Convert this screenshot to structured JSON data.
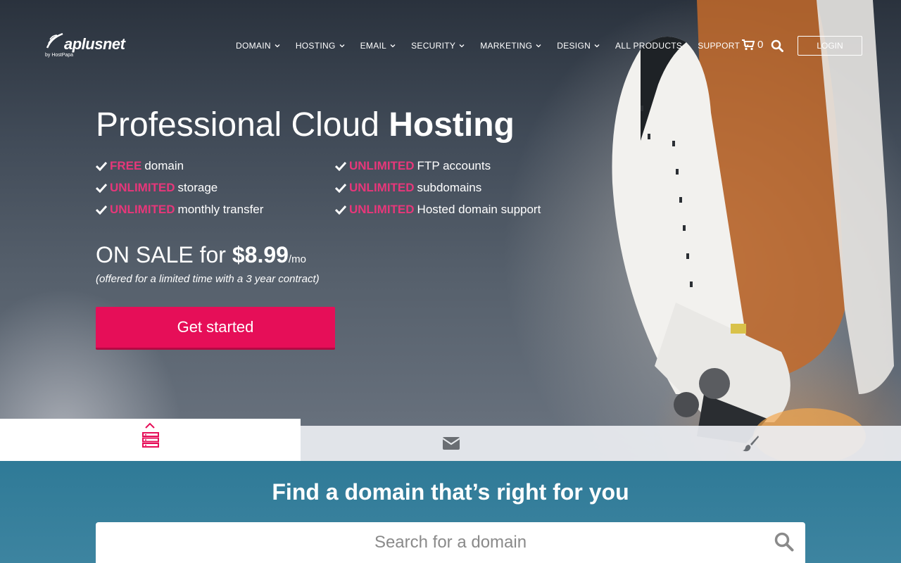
{
  "logo": {
    "name": "aplusnet",
    "byline": "by HostPapa"
  },
  "nav": {
    "items": [
      {
        "label": "DOMAIN",
        "has_dropdown": true
      },
      {
        "label": "HOSTING",
        "has_dropdown": true
      },
      {
        "label": "EMAIL",
        "has_dropdown": true
      },
      {
        "label": "SECURITY",
        "has_dropdown": true
      },
      {
        "label": "MARKETING",
        "has_dropdown": true
      },
      {
        "label": "DESIGN",
        "has_dropdown": true
      },
      {
        "label": "ALL PRODUCTS",
        "has_dropdown": false
      },
      {
        "label": "SUPPORT",
        "has_dropdown": true
      }
    ],
    "cart_count": "0",
    "login_label": "LOGIN"
  },
  "hero": {
    "title_light": "Professional Cloud ",
    "title_bold": "Hosting",
    "features": [
      {
        "highlight": "FREE",
        "text": "domain"
      },
      {
        "highlight": "UNLIMITED",
        "text": "storage"
      },
      {
        "highlight": "UNLIMITED",
        "text": "monthly transfer"
      },
      {
        "highlight": "UNLIMITED",
        "text": "FTP accounts"
      },
      {
        "highlight": "UNLIMITED",
        "text": "subdomains"
      },
      {
        "highlight": "UNLIMITED",
        "text": "Hosted domain support"
      }
    ],
    "sale_prefix": "ON SALE for ",
    "price": "$8.99",
    "price_unit": "/mo",
    "sale_note": "(offered for a limited time with a 3 year contract)",
    "cta_label": "Get started"
  },
  "tabs": [
    {
      "icon": "server-icon",
      "active": true
    },
    {
      "icon": "envelope-icon",
      "active": false
    },
    {
      "icon": "paintbrush-icon",
      "active": false
    }
  ],
  "domain_search": {
    "title": "Find a domain that’s right for you",
    "placeholder": "Search for a domain"
  },
  "colors": {
    "accent": "#e7377a",
    "cta": "#e60e58",
    "domain_bg": "#337c99"
  }
}
